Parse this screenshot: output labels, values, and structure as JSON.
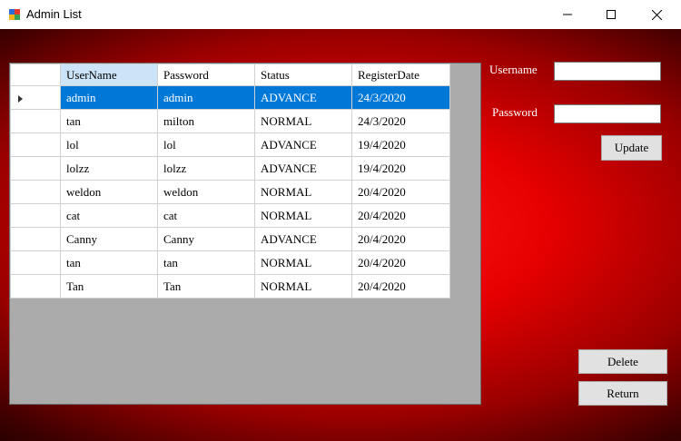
{
  "window": {
    "title": "Admin List",
    "controls": [
      "minimize",
      "maximize",
      "close"
    ]
  },
  "grid": {
    "columns": [
      "UserName",
      "Password",
      "Status",
      "RegisterDate"
    ],
    "selected_row": 0,
    "rows": [
      [
        "admin",
        "admin",
        "ADVANCE",
        "24/3/2020"
      ],
      [
        "tan",
        "milton",
        "NORMAL",
        "24/3/2020"
      ],
      [
        "lol",
        "lol",
        "ADVANCE",
        "19/4/2020"
      ],
      [
        "lolzz",
        "lolzz",
        "ADVANCE",
        "19/4/2020"
      ],
      [
        "weldon",
        "weldon",
        "NORMAL",
        "20/4/2020"
      ],
      [
        "cat",
        "cat",
        "NORMAL",
        "20/4/2020"
      ],
      [
        "Canny",
        "Canny",
        "ADVANCE",
        "20/4/2020"
      ],
      [
        "tan",
        "tan",
        "NORMAL",
        "20/4/2020"
      ],
      [
        "Tan",
        "Tan",
        "NORMAL",
        "20/4/2020"
      ]
    ]
  },
  "form": {
    "username_label": "Username",
    "username_value": "",
    "password_label": "Password",
    "password_value": "",
    "update_label": "Update",
    "delete_label": "Delete",
    "return_label": "Return"
  },
  "colors": {
    "selection": "#0078d7",
    "header_highlight": "#cce4f7",
    "background_accent": "#e60000"
  }
}
